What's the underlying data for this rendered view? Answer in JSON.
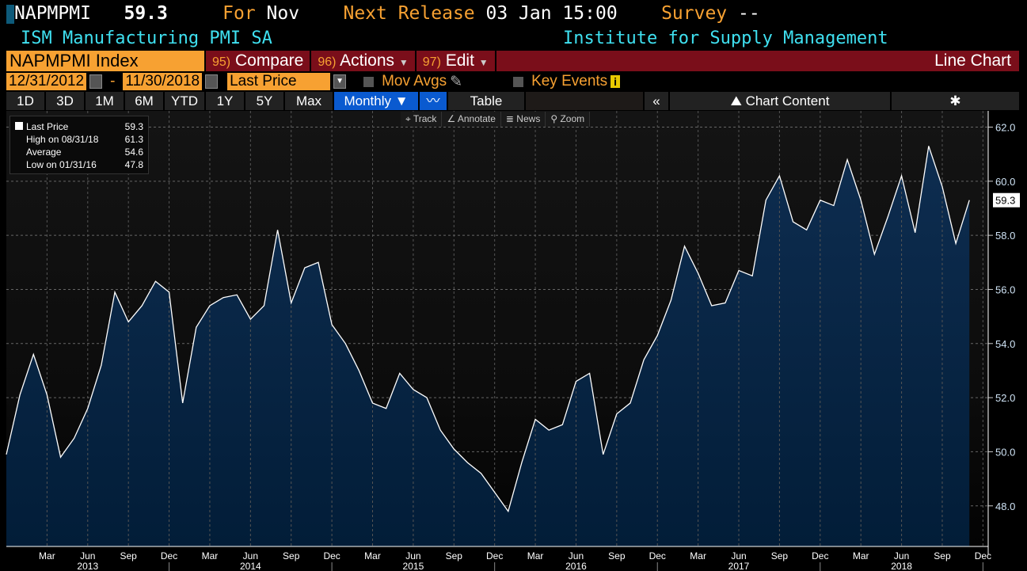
{
  "header": {
    "ticker": "NAPMPMI",
    "value": "59.3",
    "for_label": "For",
    "period": "Nov",
    "next_release_label": "Next Release",
    "next_release": "03 Jan 15:00",
    "survey_label": "Survey",
    "survey": "--",
    "name": "ISM Manufacturing PMI SA",
    "source": "Institute for Supply Management"
  },
  "toolbar": {
    "index": "NAPMPMI Index",
    "compare_num": "95)",
    "compare": "Compare",
    "actions_num": "96)",
    "actions": "Actions",
    "edit_num": "97)",
    "edit": "Edit",
    "chart_type": "Line Chart"
  },
  "range": {
    "start": "12/31/2012",
    "sep": "-",
    "end": "11/30/2018",
    "field": "Last Price",
    "mov_avgs": "Mov Avgs",
    "key_events": "Key Events"
  },
  "periods": [
    "1D",
    "3D",
    "1M",
    "6M",
    "YTD",
    "1Y",
    "5Y",
    "Max"
  ],
  "frequency": "Monthly ▼",
  "table_label": "Table",
  "collapse": "«",
  "chart_content": "Chart Content",
  "tools": [
    "⌖ Track",
    "∠ Annotate",
    "≣ News",
    "⚲ Zoom"
  ],
  "legend": [
    {
      "label": "Last Price",
      "value": "59.3"
    },
    {
      "label": "High on 08/31/18",
      "value": "61.3"
    },
    {
      "label": "Average",
      "value": "54.6"
    },
    {
      "label": "Low on 01/31/16",
      "value": "47.8"
    }
  ],
  "colors": {
    "orange": "#f7a132",
    "cyan": "#3fe0f0",
    "maroon": "#7a0e1a",
    "line": "#ffffff",
    "fill_top": "#0e2d50",
    "fill_bottom": "#021d38"
  },
  "chart_data": {
    "type": "area",
    "title": "NAPMPMI Index",
    "series": [
      {
        "name": "Last Price",
        "start": "2012-12",
        "values": [
          49.9,
          52.1,
          53.6,
          52.1,
          49.8,
          50.5,
          51.6,
          53.2,
          55.9,
          54.8,
          55.4,
          56.3,
          55.9,
          51.8,
          54.6,
          55.4,
          55.7,
          55.8,
          54.9,
          55.4,
          58.2,
          55.5,
          56.8,
          57.0,
          54.7,
          54.0,
          53.0,
          51.8,
          51.6,
          52.9,
          52.3,
          52.0,
          50.8,
          50.1,
          49.6,
          49.2,
          48.5,
          47.8,
          49.6,
          51.2,
          50.8,
          51.0,
          52.6,
          52.9,
          49.9,
          51.4,
          51.8,
          53.4,
          54.3,
          55.6,
          57.6,
          56.6,
          55.4,
          55.5,
          56.7,
          56.5,
          59.3,
          60.2,
          58.5,
          58.2,
          59.3,
          59.1,
          60.8,
          59.3,
          57.3,
          58.7,
          60.2,
          58.1,
          61.3,
          59.8,
          57.7,
          59.3
        ]
      }
    ],
    "ylim": [
      46.5,
      62.6
    ],
    "yticks": [
      "48.0",
      "50.0",
      "52.0",
      "54.0",
      "56.0",
      "58.0",
      "60.0",
      "62.0"
    ],
    "last_label": "59.3",
    "month_labels": [
      "Mar",
      "Jun",
      "Sep",
      "Dec"
    ],
    "years": [
      "2013",
      "2014",
      "2015",
      "2016",
      "2017",
      "2018"
    ],
    "grid": true
  }
}
